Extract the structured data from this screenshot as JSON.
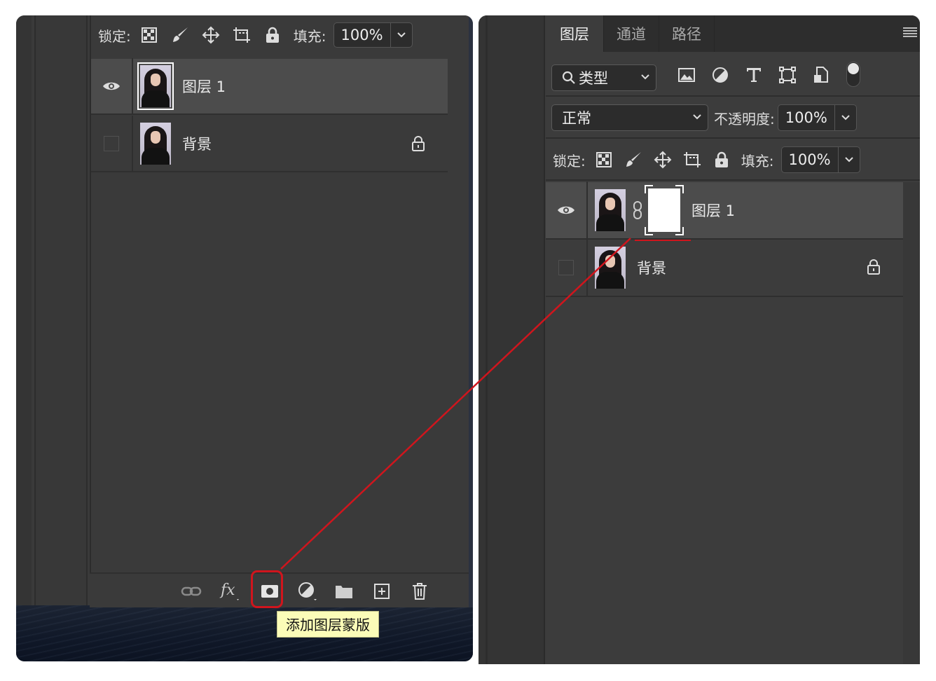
{
  "left_panel": {
    "lock_label": "锁定:",
    "fill_label": "填充:",
    "fill_value": "100%",
    "layers": [
      {
        "name": "图层 1",
        "visible": true,
        "selected": true,
        "locked": false
      },
      {
        "name": "背景",
        "visible": false,
        "selected": false,
        "locked": true
      }
    ],
    "toolbar_tooltip": "添加图层蒙版"
  },
  "right_panel": {
    "tabs": [
      "图层",
      "通道",
      "路径"
    ],
    "active_tab": "图层",
    "filter_kind": "类型",
    "blend_mode": "正常",
    "opacity_label": "不透明度:",
    "opacity_value": "100%",
    "lock_label": "锁定:",
    "fill_label": "填充:",
    "fill_value": "100%",
    "layers": [
      {
        "name": "图层 1",
        "visible": true,
        "selected": true,
        "has_mask": true,
        "locked": false
      },
      {
        "name": "背景",
        "visible": false,
        "selected": false,
        "has_mask": false,
        "locked": true
      }
    ]
  },
  "colors": {
    "panel_bg": "#3a3a3a",
    "selected_row": "#4c4c4c",
    "annotation_red": "#d0151d",
    "tooltip_bg": "#fbfcb8"
  },
  "icons": [
    "checkerboard-lock-icon",
    "brush-icon",
    "move-icon",
    "artboard-icon",
    "lock-icon",
    "chevron-down-icon",
    "eye-icon",
    "link-icon",
    "fx-icon",
    "layer-mask-icon",
    "adjustment-icon",
    "folder-icon",
    "new-layer-icon",
    "trash-icon",
    "search-icon",
    "image-filter-icon",
    "adjustment-filter-icon",
    "type-filter-icon",
    "shape-filter-icon",
    "smart-object-filter-icon",
    "menu-icon",
    "chain-link-icon"
  ]
}
